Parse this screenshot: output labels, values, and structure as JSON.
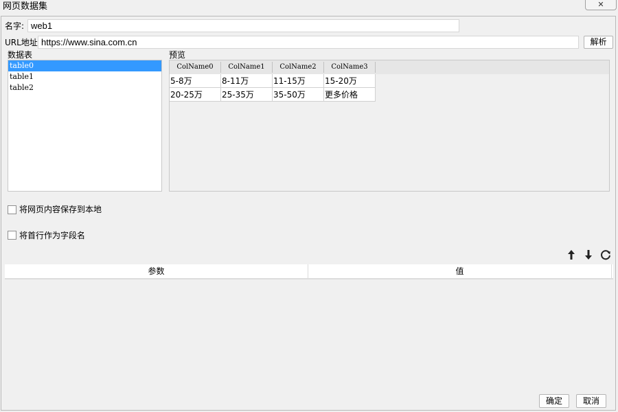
{
  "window": {
    "title": "网页数据集",
    "close_glyph": "✕"
  },
  "form": {
    "name_label": "名字:",
    "name_value": "web1",
    "url_label": "URL地址",
    "url_value": "https://www.sina.com.cn",
    "parse_button": "解析"
  },
  "tables_panel": {
    "label": "数据表",
    "items": [
      {
        "label": "table0",
        "selected": true
      },
      {
        "label": "table1",
        "selected": false
      },
      {
        "label": "table2",
        "selected": false
      }
    ]
  },
  "preview": {
    "label": "预览",
    "columns": [
      "ColName0",
      "ColName1",
      "ColName2",
      "ColName3"
    ],
    "rows": [
      [
        "5-8万",
        "8-11万",
        "11-15万",
        "15-20万"
      ],
      [
        "20-25万",
        "25-35万",
        "35-50万",
        "更多价格"
      ]
    ]
  },
  "options": {
    "save_local_label": "将网页内容保存到本地",
    "save_local_checked": false,
    "first_row_header_label": "将首行作为字段名",
    "first_row_header_checked": false
  },
  "toolbar": {
    "icons": [
      "arrow-up-icon",
      "arrow-down-icon",
      "refresh-icon"
    ]
  },
  "params_table": {
    "columns": [
      "参数",
      "值"
    ]
  },
  "footer": {
    "ok_button": "确定",
    "cancel_button": "取消"
  }
}
